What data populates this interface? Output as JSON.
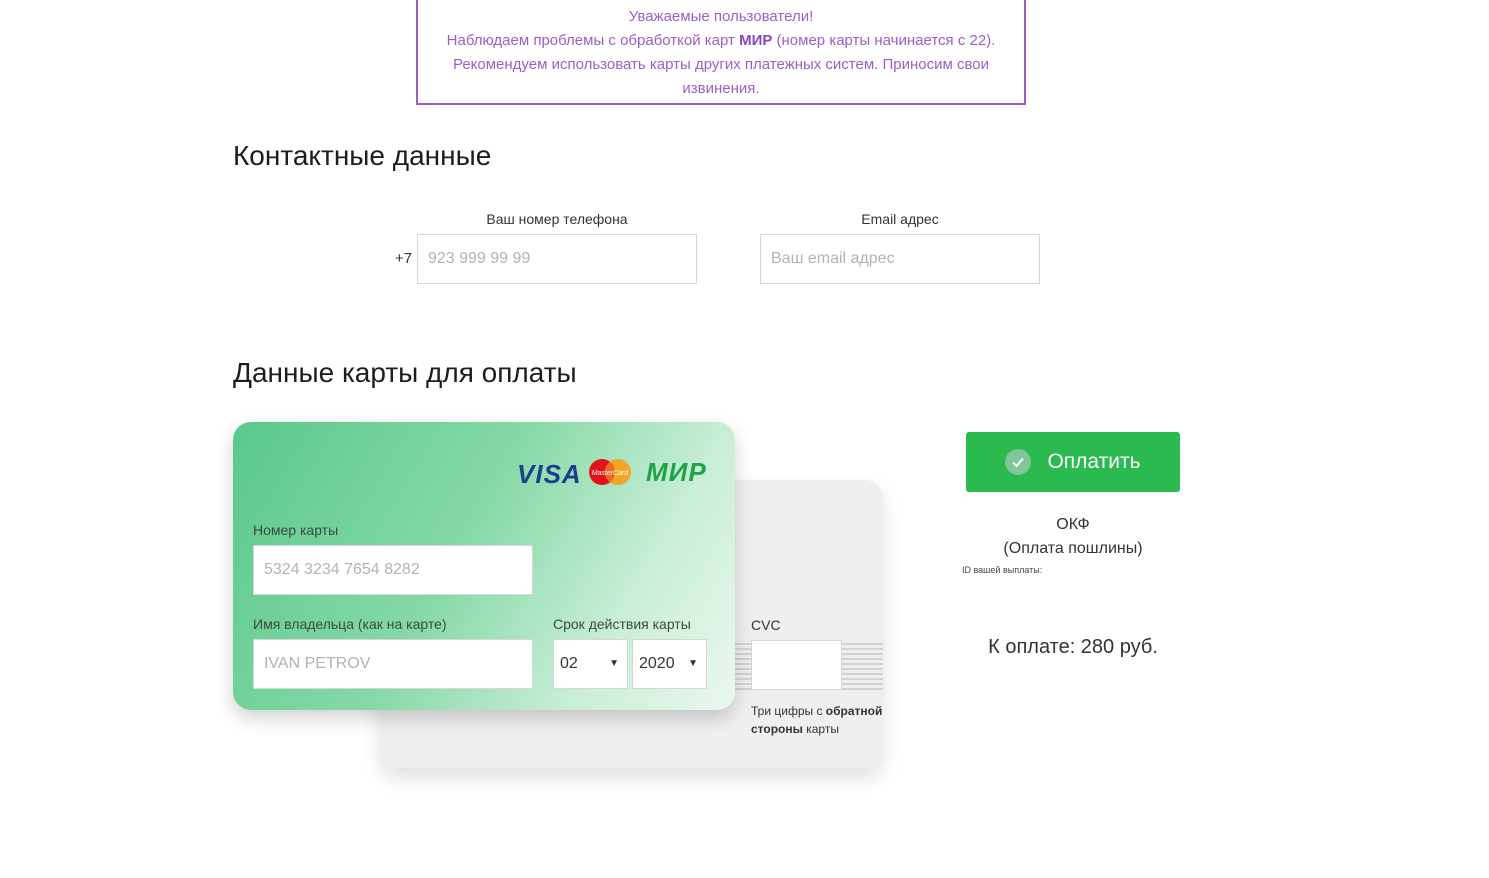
{
  "notice": {
    "line1": "Уважаемые пользователи!",
    "line2_pre": "Наблюдаем проблемы с обработкой карт ",
    "line2_bold": "МИР",
    "line2_post": " (номер карты начинается с 22).",
    "line3": "Рекомендуем использовать карты других платежных систем. Приносим свои",
    "line4": "извинения."
  },
  "contacts": {
    "title": "Контактные данные",
    "phone_label": "Ваш номер телефона",
    "phone_prefix": "+7",
    "phone_placeholder": "923 999 99 99",
    "email_label": "Email адрес",
    "email_placeholder": "Ваш email адрес"
  },
  "card": {
    "title": "Данные карты для оплаты",
    "logos": {
      "visa": "VISA",
      "mastercard": "MasterCard",
      "mir": "МИР"
    },
    "number_label": "Номер карты",
    "number_placeholder": "5324 3234 7654 8282",
    "holder_label": "Имя владельца (как на карте)",
    "holder_placeholder": "IVAN PETROV",
    "expiry_label": "Срок действия карты",
    "expiry_month": "02",
    "expiry_year": "2020",
    "cvc_label": "CVC",
    "cvc_hint_pre": "Три цифры с ",
    "cvc_hint_bold": "обратной стороны",
    "cvc_hint_post": " карты"
  },
  "payment": {
    "button_label": "Оплатить",
    "service_line1": "ОКФ",
    "service_line2": "(Оплата пошлины)",
    "id_label": "ID вашей выплаты:",
    "amount": "К оплате: 280 руб."
  },
  "colors": {
    "notice": "#9b5fc7",
    "pay_button": "#2bba4f",
    "card_gradient_start": "#5ac98a"
  }
}
